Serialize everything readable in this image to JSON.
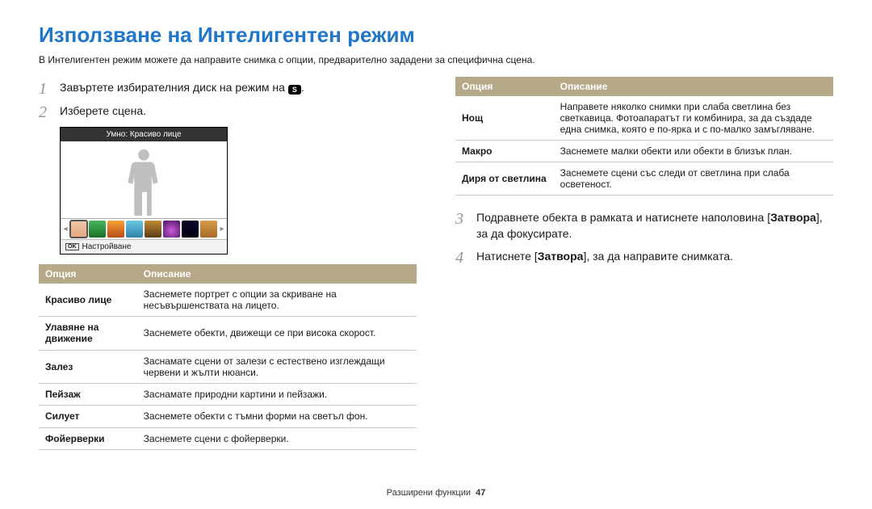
{
  "title": "Използване на Интелигентен режим",
  "intro": "В Интелигентен режим можете да направите снимка с опции, предварително зададени за специфична сцена.",
  "left": {
    "step1_pre": "Завъртете избирателния диск на режим на ",
    "step1_post": ".",
    "mode_icon_label": "S",
    "step2": "Изберете сцена.",
    "screen": {
      "top": "Умно: Красиво лице",
      "foot_ok": "OK",
      "foot_label": "Настройване",
      "thumbs": [
        {
          "bg": "linear-gradient(#efc7a8,#e7a880)"
        },
        {
          "bg": "linear-gradient(#49b55d,#1b6f2a)"
        },
        {
          "bg": "linear-gradient(#f6a13a,#b84c11)"
        },
        {
          "bg": "linear-gradient(#6bc8e6,#2f81a8)"
        },
        {
          "bg": "linear-gradient(#c08a33,#5a3c14)"
        },
        {
          "bg": "radial-gradient(circle at 50% 60%,#c95bd8,#4a1260)"
        },
        {
          "bg": "linear-gradient(#0a0628,#000010)"
        },
        {
          "bg": "linear-gradient(#d99b46,#a56b2a)"
        }
      ]
    },
    "table": {
      "head": {
        "opt": "Опция",
        "desc": "Описание"
      },
      "rows": [
        {
          "name": "Красиво лице",
          "desc": "Заснемете портрет с опции за скриване на несъвършенствата на лицето."
        },
        {
          "name": "Улавяне на движение",
          "desc": "Заснемете обекти, движещи се при висока скорост."
        },
        {
          "name": "Залез",
          "desc": "Заснамате сцени от залези с естествено изглеждащи червени и жълти нюанси."
        },
        {
          "name": "Пейзаж",
          "desc": "Заснамате природни картини и пейзажи."
        },
        {
          "name": "Силует",
          "desc": "Заснемете обекти с тъмни форми на светъл фон."
        },
        {
          "name": "Фойерверки",
          "desc": "Заснемете сцени с фойерверки."
        }
      ]
    }
  },
  "right": {
    "table": {
      "head": {
        "opt": "Опция",
        "desc": "Описание"
      },
      "rows": [
        {
          "name": "Нощ",
          "desc": "Направете няколко снимки при слаба светлина без светкавица. Фотоапаратът ги комбинира, за да създаде една снимка, която е по-ярка и с по-малко замъгляване."
        },
        {
          "name": "Макро",
          "desc": "Заснемете малки обекти или обекти в близък план."
        },
        {
          "name": "Диря от светлина",
          "desc": "Заснемете сцени със следи от светлина при слаба осветеност."
        }
      ]
    },
    "step3_pre": "Подравнете обекта в рамката и натиснете наполовина [",
    "step3_bold": "Затвора",
    "step3_post": "], за да фокусирате.",
    "step4_pre": "Натиснете [",
    "step4_bold": "Затвора",
    "step4_post": "], за да направите снимката."
  },
  "footer": {
    "section": "Разширени функции",
    "page": "47"
  }
}
